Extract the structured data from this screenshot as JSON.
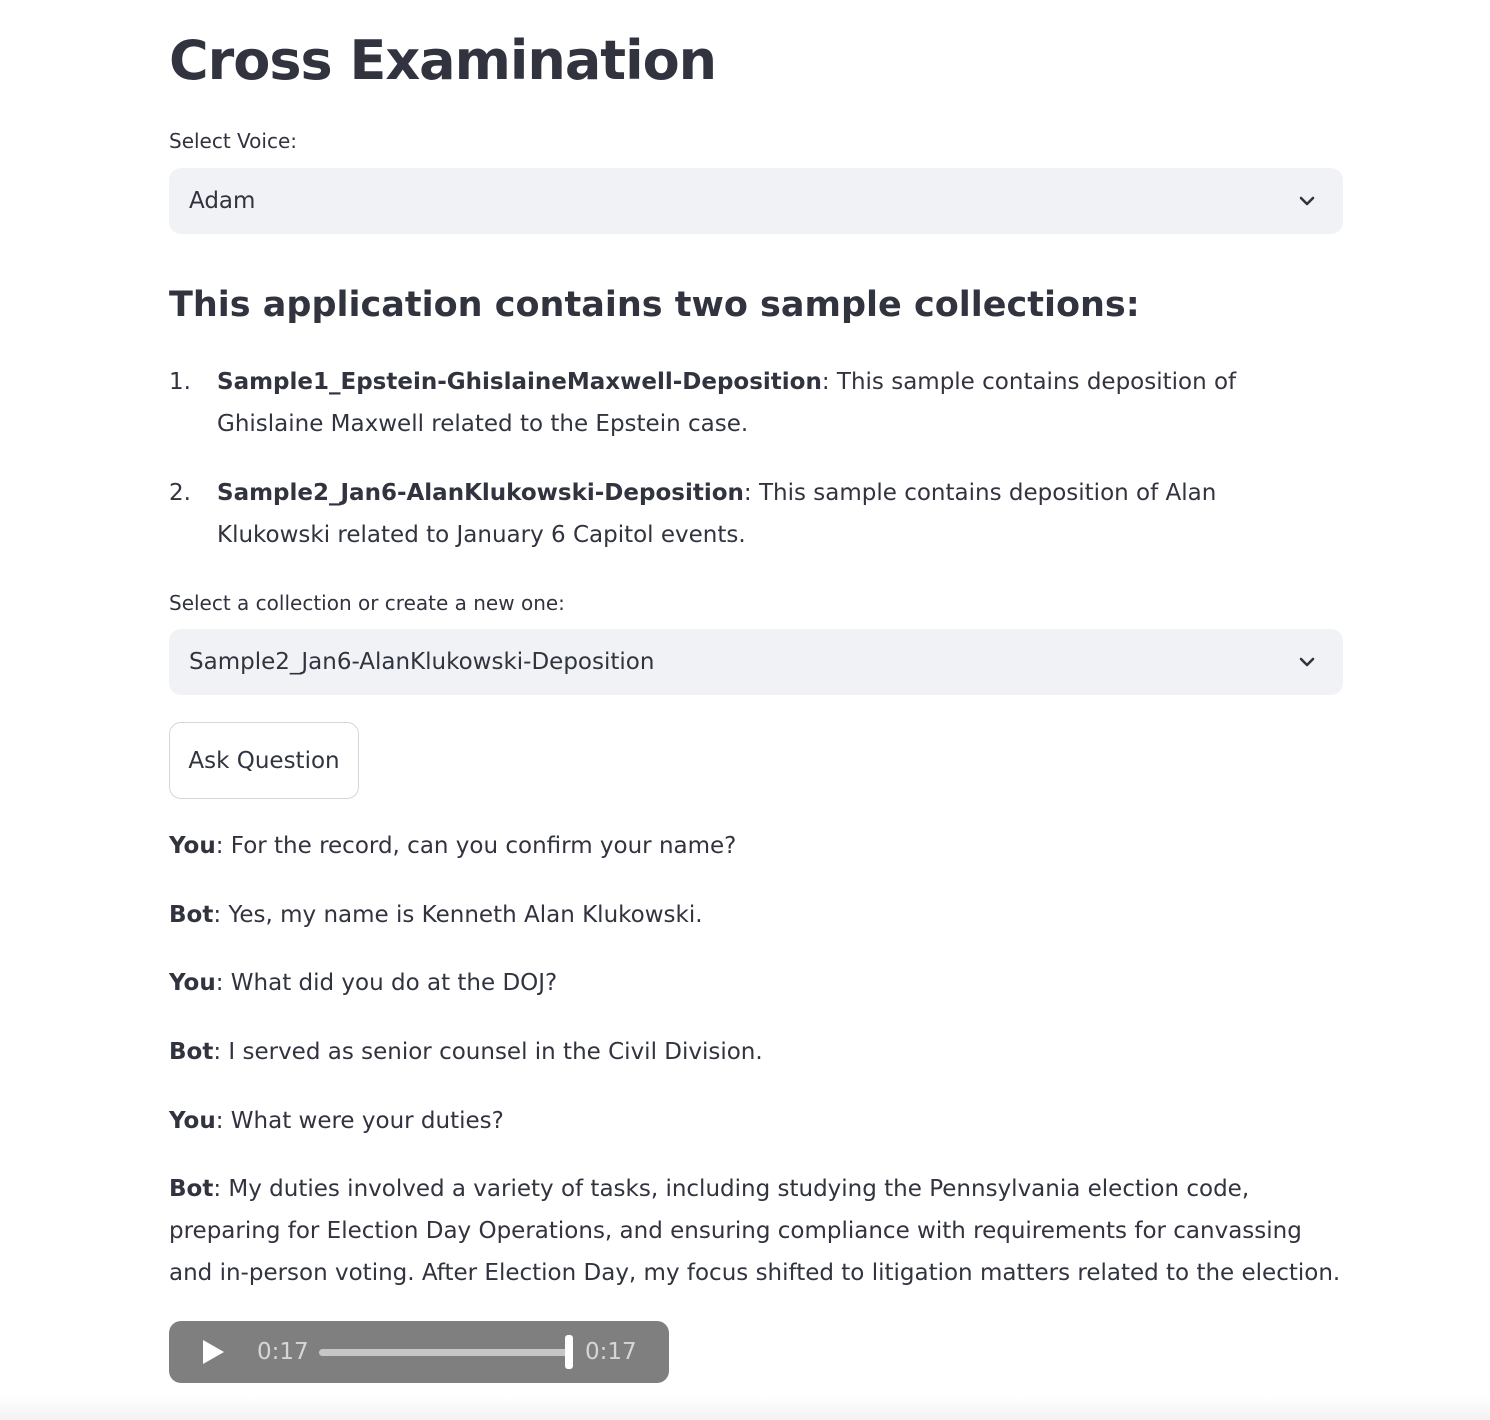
{
  "page": {
    "title": "Cross Examination"
  },
  "voice_select": {
    "label": "Select Voice:",
    "value": "Adam"
  },
  "collections_info": {
    "heading": "This application contains two sample collections:",
    "items": [
      {
        "number": "1.",
        "name": "Sample1_Epstein-GhislaineMaxwell-Deposition",
        "description": ": This sample contains deposition of Ghislaine Maxwell related to the Epstein case."
      },
      {
        "number": "2.",
        "name": "Sample2_Jan6-AlanKlukowski-Deposition",
        "description": ": This sample contains deposition of Alan Klukowski related to January 6 Capitol events."
      }
    ]
  },
  "collection_select": {
    "label": "Select a collection or create a new one:",
    "value": "Sample2_Jan6-AlanKlukowski-Deposition"
  },
  "ask_button": {
    "label": "Ask Question"
  },
  "conversation": [
    {
      "speaker": "You",
      "text": ": For the record, can you confirm your name?"
    },
    {
      "speaker": "Bot",
      "text": ": Yes, my name is Kenneth Alan Klukowski."
    },
    {
      "speaker": "You",
      "text": ": What did you do at the DOJ?"
    },
    {
      "speaker": "Bot",
      "text": ": I served as senior counsel in the Civil Division."
    },
    {
      "speaker": "You",
      "text": ": What were your duties?"
    },
    {
      "speaker": "Bot",
      "text": ": My duties involved a variety of tasks, including studying the Pennsylvania election code, preparing for Election Day Operations, and ensuring compliance with requirements for canvassing and in-person voting. After Election Day, my focus shifted to litigation matters related to the election."
    }
  ],
  "audio_player": {
    "current_time": "0:17",
    "duration": "0:17",
    "progress": 1.0,
    "play_icon": "play-icon"
  },
  "colors": {
    "text": "#31333f",
    "select_bg": "#f0f2f6",
    "button_border": "#d4d6dc",
    "audio_bg": "#7f7f7f"
  }
}
